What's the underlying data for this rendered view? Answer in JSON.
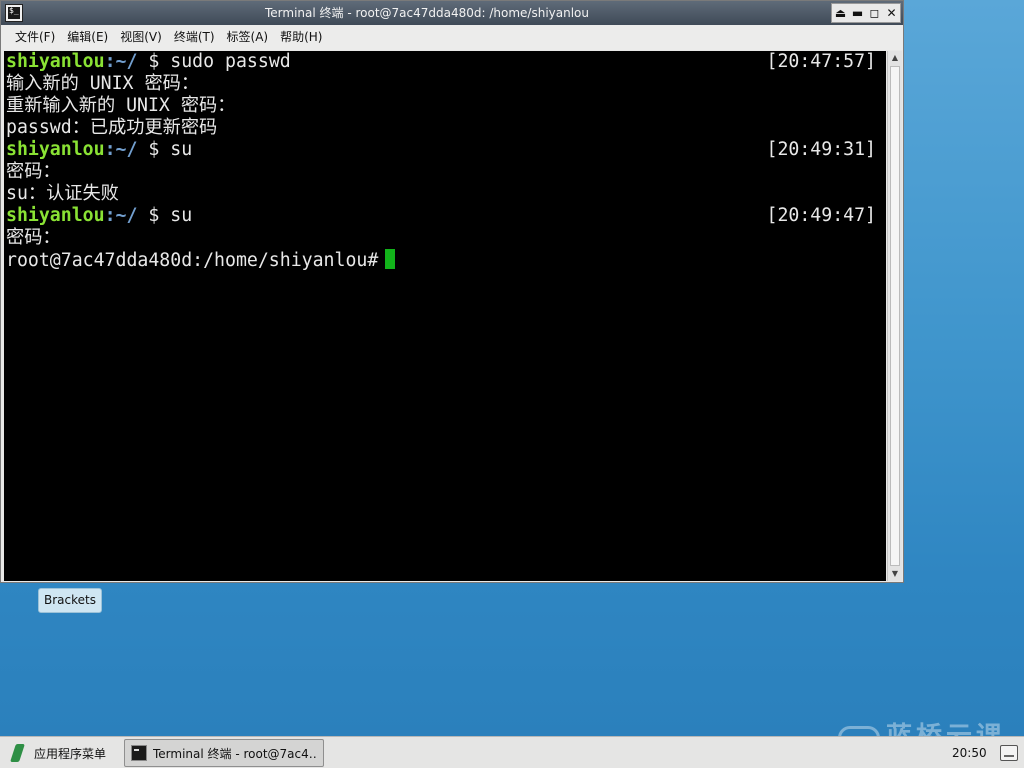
{
  "window": {
    "title": "Terminal 终端 - root@7ac47dda480d: /home/shiyanlou",
    "title_icon_glyph": "$_",
    "controls": [
      "⏏",
      "▬",
      "◻",
      "✕"
    ]
  },
  "menubar": {
    "items": [
      "文件(F)",
      "编辑(E)",
      "视图(V)",
      "终端(T)",
      "标签(A)",
      "帮助(H)"
    ]
  },
  "terminal": {
    "colors": {
      "background": "#000000",
      "text": "#e8e8e8",
      "user": "#8ae234",
      "path": "#729fcf",
      "cursor": "#12b31a"
    },
    "lines": [
      {
        "user": "shiyanlou",
        "sep": ":",
        "path": "~/",
        "rest": " $ sudo passwd",
        "time": "[20:47:57]"
      },
      {
        "text": "输入新的 UNIX 密码："
      },
      {
        "text": "重新输入新的 UNIX 密码："
      },
      {
        "text": "passwd：已成功更新密码"
      },
      {
        "user": "shiyanlou",
        "sep": ":",
        "path": "~/",
        "rest": " $ su",
        "time": "[20:49:31]"
      },
      {
        "text": "密码："
      },
      {
        "text": "su：认证失败"
      },
      {
        "user": "shiyanlou",
        "sep": ":",
        "path": "~/",
        "rest": " $ su",
        "time": "[20:49:47]"
      },
      {
        "text": "密码："
      },
      {
        "text": "root@7ac47dda480d:/home/shiyanlou#"
      }
    ]
  },
  "scrollbar": {
    "up_arrow": "▲",
    "down_arrow": "▼"
  },
  "desktop": {
    "tooltip": "Brackets",
    "watermark": "蓝桥云课"
  },
  "taskbar": {
    "start_label": "应用程序菜单",
    "task_label": "Terminal 终端 - root@7ac4…",
    "clock": "20:50"
  }
}
